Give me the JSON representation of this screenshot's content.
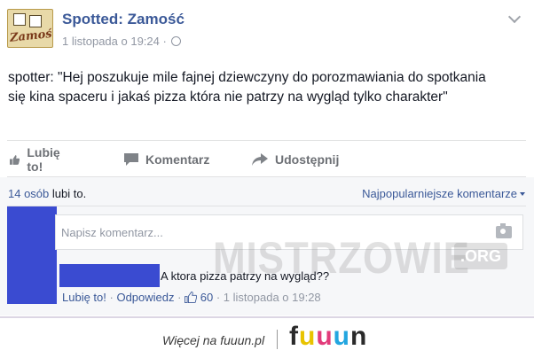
{
  "post": {
    "page_name": "Spotted: Zamość",
    "avatar_text": "Zamość",
    "timestamp": "1 listopada o 19:24",
    "meta_separator": "·",
    "text": "spotter: \"Hej poszukuje mile fajnej dziewczyny do porozmawiania do spotkania się kina spaceru i jakaś pizza która nie patrzy na wygląd tylko charakter\""
  },
  "actions": {
    "like": "Lubię to!",
    "comment": "Komentarz",
    "share": "Udostępnij"
  },
  "comments": {
    "likes_count": "14 osób",
    "likes_suffix": "lubi to.",
    "sort_label": "Najpopularniejsze komentarze",
    "input_placeholder": "Napisz komentarz...",
    "watermark": "MISTRZOWIE",
    "watermark_suffix": ".ORG",
    "reply": {
      "text": "A ktora pizza patrzy na wygląd??",
      "like": "Lubię to!",
      "reply": "Odpowiedz",
      "reactions": "60",
      "timestamp": "1 listopada o 19:28",
      "sep": "·"
    }
  },
  "footer": {
    "more": "Więcej na fuuun.pl",
    "brand_letters": [
      "f",
      "u",
      "u",
      "u",
      "n"
    ],
    "brand_colors": [
      "#2a2a2a",
      "#e8c300",
      "#e23b7a",
      "#23a6e0",
      "#2a2a2a"
    ]
  },
  "colors": {
    "link": "#3b5998",
    "censor": "#3a4bd1"
  }
}
